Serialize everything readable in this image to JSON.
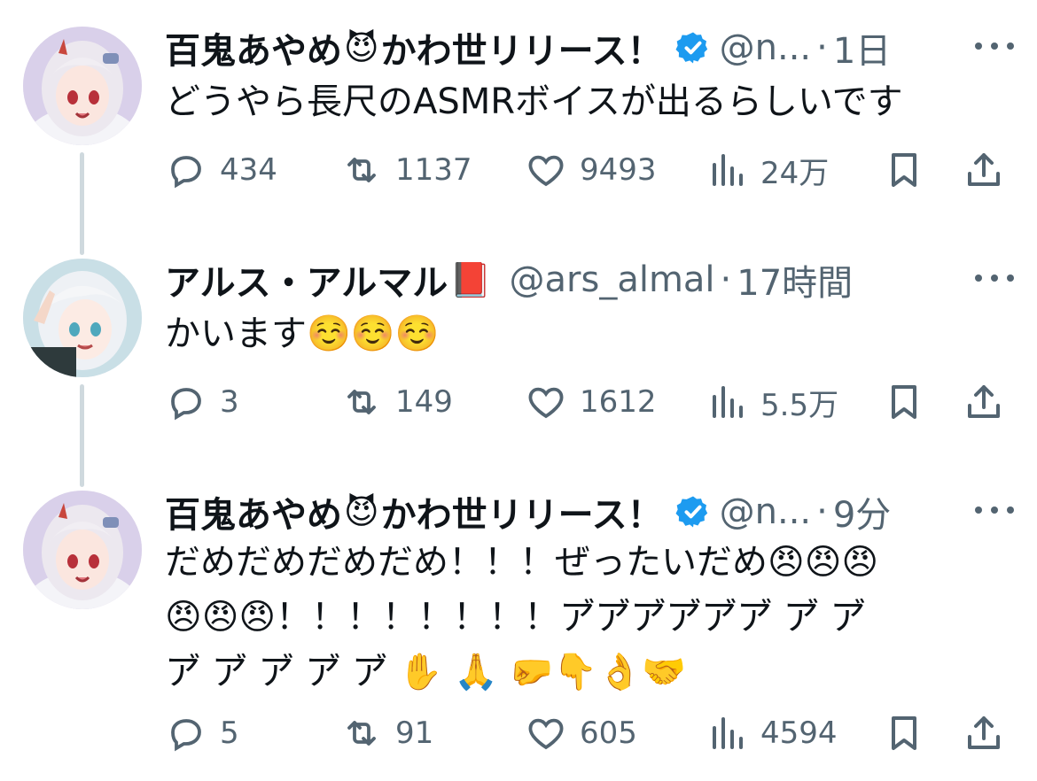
{
  "colors": {
    "text": "#0f1419",
    "muted": "#536471",
    "verified": "#1d9bf0",
    "thread_line": "#cfd9de"
  },
  "tweets": [
    {
      "name": "百鬼あやめ",
      "name_emoji": "😈",
      "name_suffix": "かわ世リリース！",
      "verified": true,
      "handle": "@n...",
      "separator": "·",
      "time": "1日",
      "text": "どうやら長尺のASMRボイスが出るらしいです",
      "replies": "434",
      "retweets": "1137",
      "likes": "9493",
      "views": "24万"
    },
    {
      "name": "アルス・アルマル",
      "name_emoji": "📕",
      "name_suffix": "",
      "verified": false,
      "handle": "@ars_almal",
      "separator": "·",
      "time": "17時間",
      "text": "かいます☺️☺️☺️",
      "replies": "3",
      "retweets": "149",
      "likes": "1612",
      "views": "5.5万"
    },
    {
      "name": "百鬼あやめ",
      "name_emoji": "😈",
      "name_suffix": "かわ世リリース！",
      "verified": true,
      "handle": "@n...",
      "separator": "·",
      "time": "9分",
      "text": "だめだめだめだめ！！！ぜったいだめ😠😠😠\n😠😠😠！！！！！！！！ア゙ア゙ア゙ア゙ア゙ア゙ ア゙ ア゙\nア゙ ア゙ ア゙ ア゙ ア゙ ✋ 🙏 🤛👇👌🤝",
      "replies": "5",
      "retweets": "91",
      "likes": "605",
      "views": "4594"
    }
  ]
}
